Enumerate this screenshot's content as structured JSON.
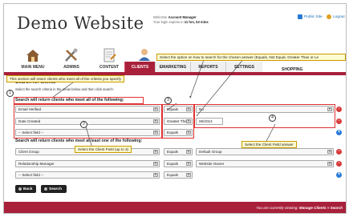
{
  "header": {
    "logo": "Demo Website",
    "welcome_prefix": "Welcome",
    "account": "Account Manager",
    "expiry_prefix": "Your login expires in",
    "expiry": "11 hrs, 53 mins",
    "public_site": "Public Site",
    "logout": "Logout"
  },
  "nav": {
    "main_menu": "MAIN MENU",
    "admins": "ADMINS",
    "content": "CONTENT",
    "clients": "CLIENTS",
    "emarketing": "EMARKETING",
    "reports": "REPORTS",
    "settings": "SETTINGS",
    "shopping": "SHOPPING"
  },
  "page": {
    "heading": "Search for clients",
    "instructions": "Select the search criteria in the areas below and then click search:",
    "all_title": "Search will return clients who meet all of the following:",
    "any_title": "Search will return clients who meet at least one of the following:"
  },
  "all_rows": [
    {
      "field": "Email Verified",
      "operator": "Equals",
      "value": "No"
    },
    {
      "field": "Date Created",
      "operator": "Greater Than",
      "value": "06/2013"
    },
    {
      "field": "-- Select field --",
      "operator": "Equals",
      "value": ""
    }
  ],
  "any_rows": [
    {
      "field": "Client Group",
      "operator": "Equals",
      "value": "Default Group"
    },
    {
      "field": "Relationship Manager",
      "operator": "Equals",
      "value": "Website Owner"
    },
    {
      "field": "-- Select field --",
      "operator": "Equals",
      "value": ""
    }
  ],
  "buttons": {
    "back": "Back",
    "search": "Search"
  },
  "footer": {
    "prefix": "You are currently viewing:",
    "location": "Manage Clients » Search"
  },
  "annotations": {
    "c_top": "Select the option on how to search for the chosen answer (Equals, Not Equal, Greater Than or Le",
    "c_section": "This section will return clients who meet all of the criteria you specify",
    "c_field": "Select the Client Field (up to 3)",
    "c_answer": "Select the Client Field answer",
    "n1": "1",
    "n2": "2",
    "n3": "3",
    "n4": "4"
  },
  "colors": {
    "brand": "#a8203a",
    "link": "#1a6fb5",
    "annotation_box": "#e03030"
  }
}
